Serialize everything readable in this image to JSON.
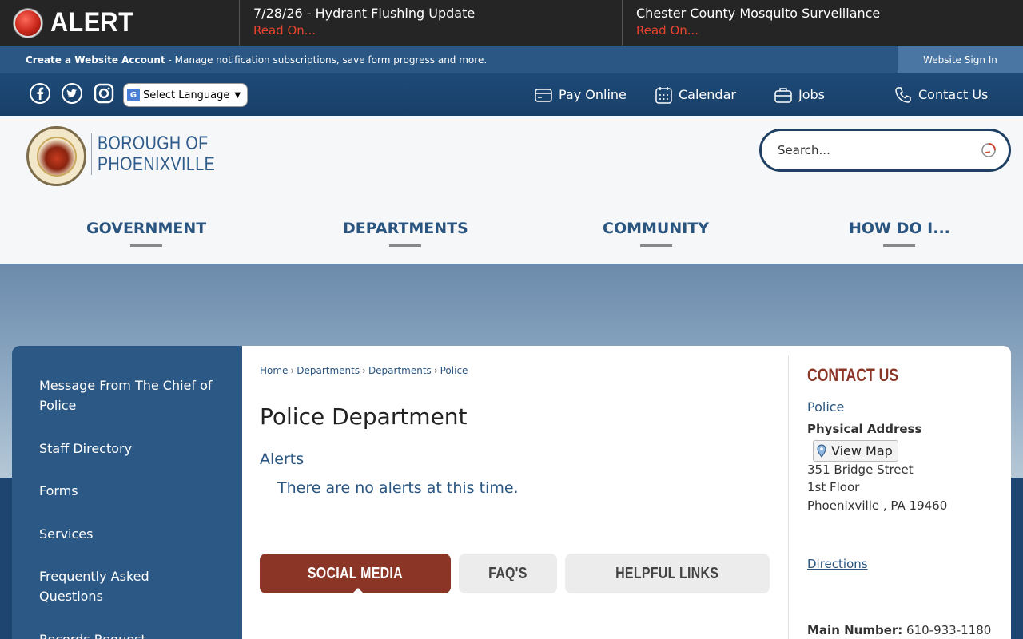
{
  "alert_bar": {
    "label": "ALERT",
    "items": [
      {
        "title": "7/28/26 - Hydrant Flushing Update",
        "link": "Read On..."
      },
      {
        "title": "Chester County Mosquito Surveillance",
        "link": "Read On..."
      }
    ]
  },
  "account_bar": {
    "create_label": "Create a Website Account",
    "create_desc": " - Manage notification subscriptions, save form progress and more.",
    "sign_in": "Website Sign In"
  },
  "utility": {
    "language_select": "Select Language",
    "quick_links": [
      {
        "label": "Pay Online",
        "icon": "credit-card-icon"
      },
      {
        "label": "Calendar",
        "icon": "calendar-icon"
      },
      {
        "label": "Jobs",
        "icon": "briefcase-icon"
      },
      {
        "label": "Contact Us",
        "icon": "phone-icon"
      }
    ]
  },
  "header": {
    "logo_line1": "BOROUGH OF",
    "logo_line2": "PHOENIXVILLE",
    "search_placeholder": "Search...",
    "nav": [
      "GOVERNMENT",
      "DEPARTMENTS",
      "COMMUNITY",
      "HOW DO I..."
    ]
  },
  "sidebar": {
    "items": [
      "Message From The Chief of Police",
      "Staff Directory",
      "Forms",
      "Services",
      "Frequently Asked Questions",
      "Records Request"
    ]
  },
  "main": {
    "breadcrumb": [
      "Home",
      "Departments",
      "Departments",
      "Police"
    ],
    "title": "Police Department",
    "alerts_heading": "Alerts",
    "alerts_message": "There are no alerts at this time.",
    "tabs": [
      "SOCIAL MEDIA",
      "FAQ'S",
      "HELPFUL LINKS"
    ]
  },
  "contact": {
    "heading": "CONTACT US",
    "name": "Police",
    "physical_label": "Physical Address",
    "view_map": "View Map",
    "address_line1": "351 Bridge Street",
    "address_line2": "1st Floor",
    "address_line3": "Phoenixville , PA 19460",
    "directions": "Directions",
    "main_number_label": "Main Number:",
    "main_number": "610-933-1180"
  },
  "colors": {
    "primary_blue": "#2b5785",
    "accent_red": "#8b3527",
    "alert_link": "#e8442f"
  }
}
